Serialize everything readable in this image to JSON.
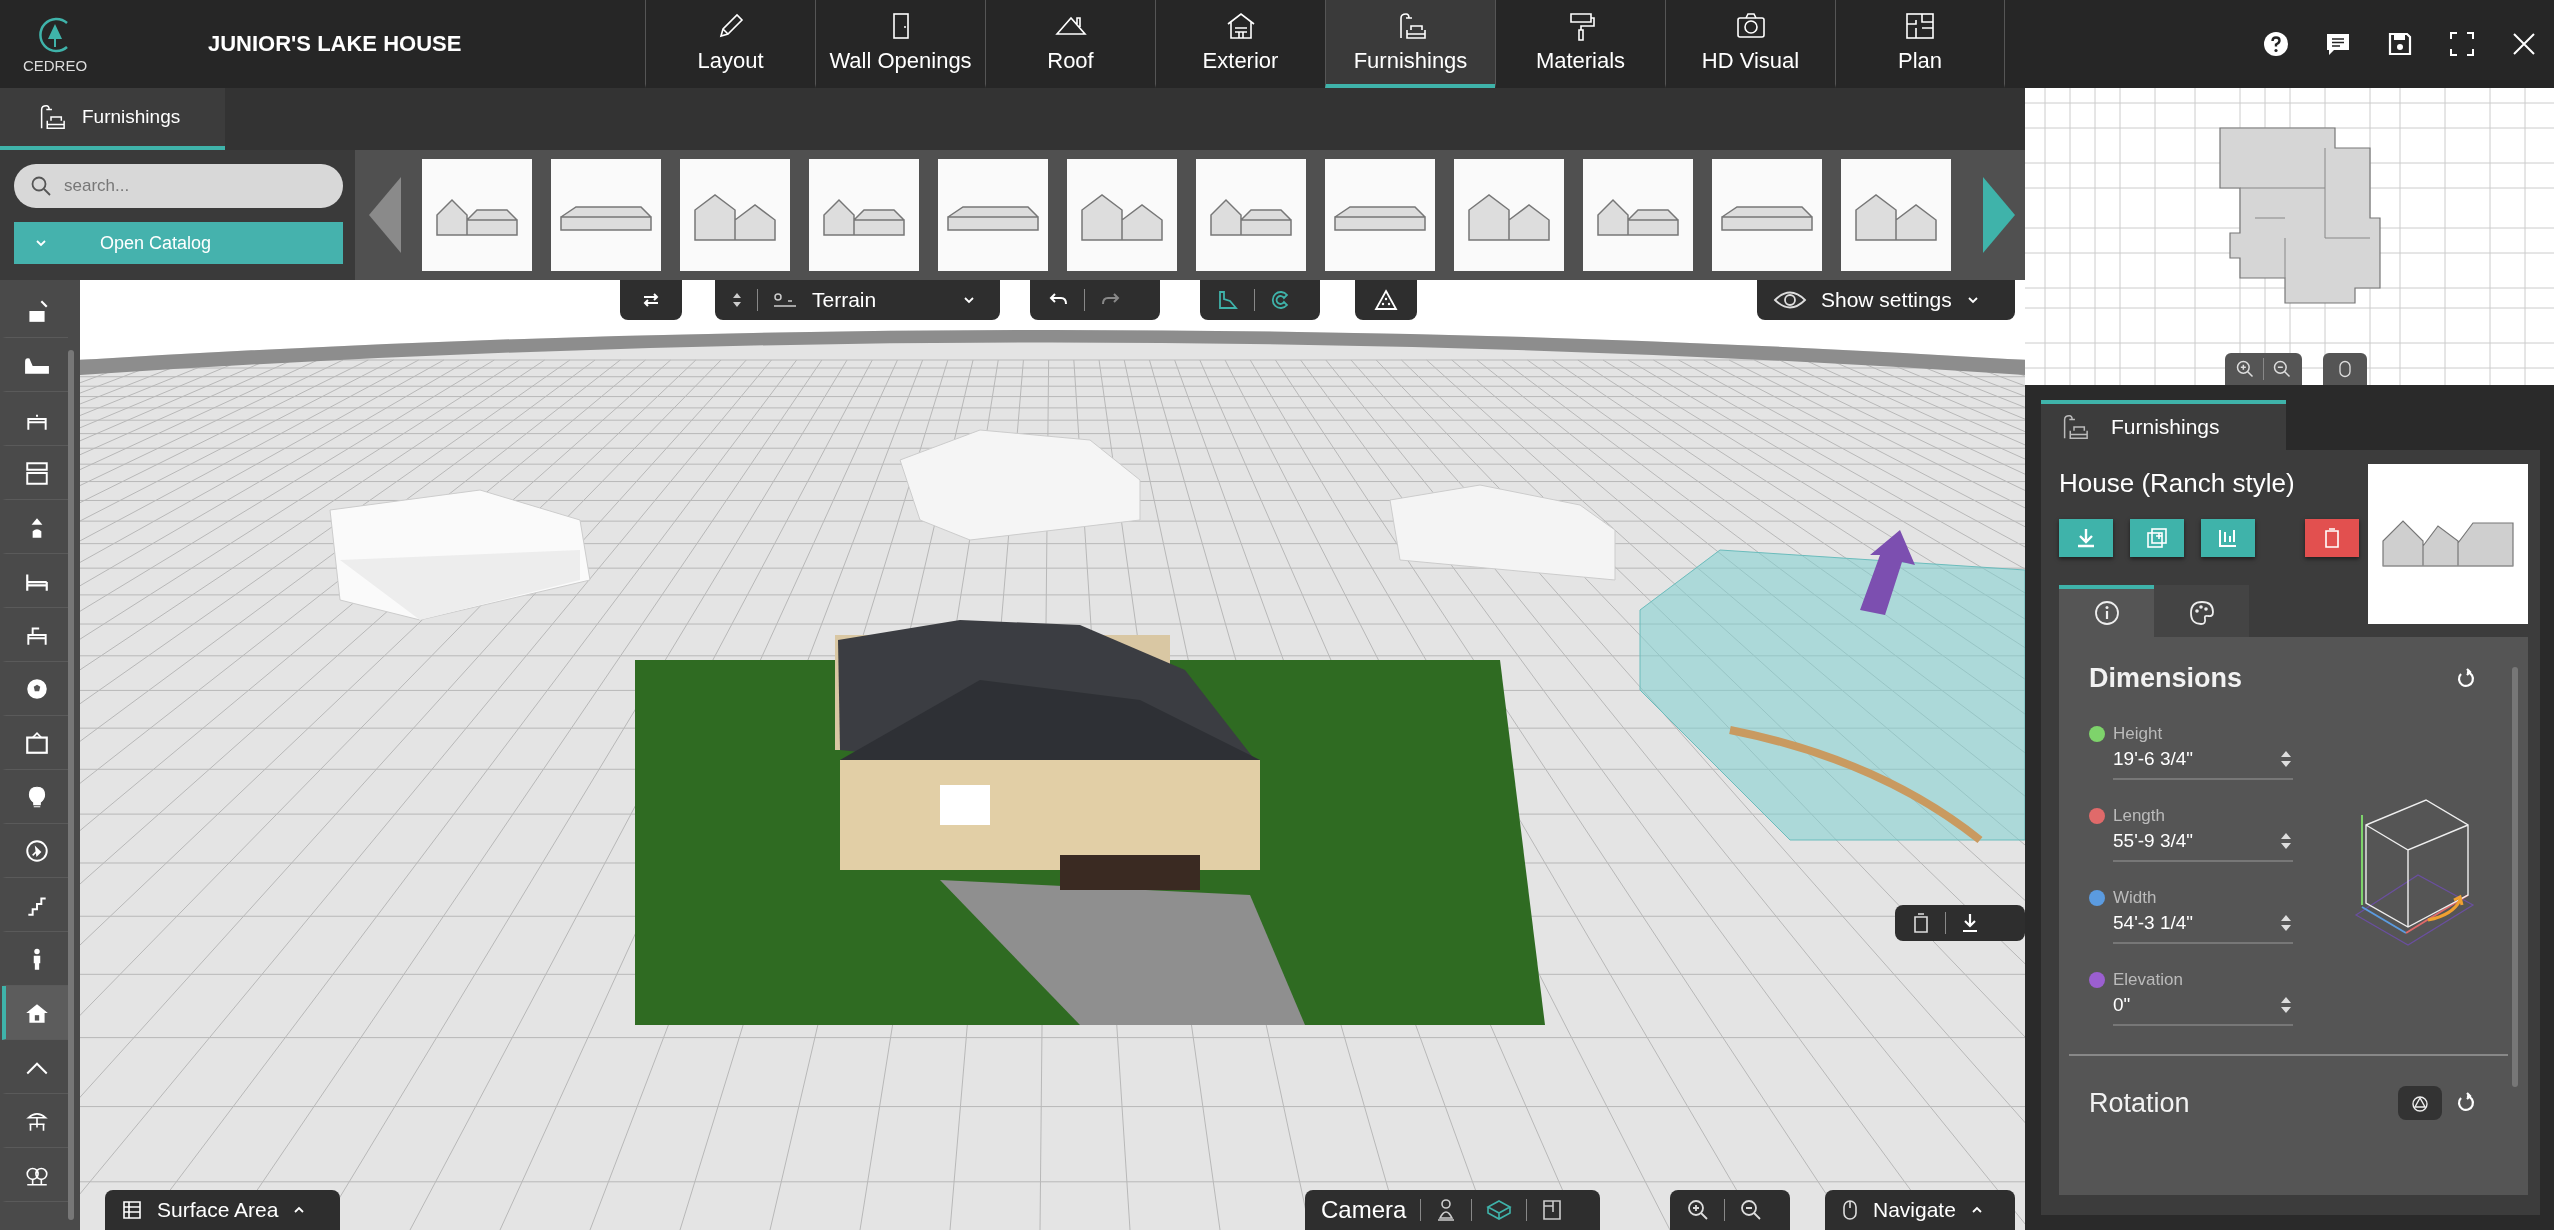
{
  "header": {
    "logo_text": "CEDREO",
    "project_title": "JUNIOR'S LAKE HOUSE",
    "tabs": [
      {
        "label": "Layout",
        "selected": false
      },
      {
        "label": "Wall Openings",
        "selected": false
      },
      {
        "label": "Roof",
        "selected": false
      },
      {
        "label": "Exterior",
        "selected": false
      },
      {
        "label": "Furnishings",
        "selected": true
      },
      {
        "label": "Materials",
        "selected": false
      },
      {
        "label": "HD Visual",
        "selected": false
      },
      {
        "label": "Plan",
        "selected": false
      }
    ]
  },
  "subtabs": [
    {
      "label": "Furnishings",
      "selected": true
    }
  ],
  "catalog": {
    "search": {
      "placeholder": "search..."
    },
    "open_catalog": "Open Catalog"
  },
  "tools": [
    {
      "selected": false
    },
    {
      "selected": false
    },
    {
      "selected": false
    },
    {
      "selected": false
    },
    {
      "selected": false
    },
    {
      "selected": false
    },
    {
      "selected": false
    },
    {
      "selected": false
    },
    {
      "selected": false
    },
    {
      "selected": false
    },
    {
      "selected": false
    },
    {
      "selected": false
    },
    {
      "selected": false
    },
    {
      "selected": true
    },
    {
      "selected": false
    },
    {
      "selected": false
    },
    {
      "selected": false
    }
  ],
  "viewport": {
    "terrain_dropdown": "Terrain",
    "show_settings": "Show settings",
    "surface_area": "Surface Area",
    "camera": "Camera",
    "navigate": "Navigate"
  },
  "properties": {
    "tab": "Furnishings",
    "object_name": "House (Ranch style)",
    "detail_tabs": [
      {
        "selected": true
      },
      {
        "selected": false
      }
    ],
    "dimensions_title": "Dimensions",
    "fields": [
      {
        "label": "Height",
        "value": "19'-6 3/4\"",
        "color": "#7ed36b"
      },
      {
        "label": "Length",
        "value": "55'-9 3/4\"",
        "color": "#e06a6a"
      },
      {
        "label": "Width",
        "value": "54'-3 1/4\"",
        "color": "#5b9be0"
      },
      {
        "label": "Elevation",
        "value": "0\"",
        "color": "#9b5fd0"
      }
    ],
    "rotation_title": "Rotation"
  }
}
